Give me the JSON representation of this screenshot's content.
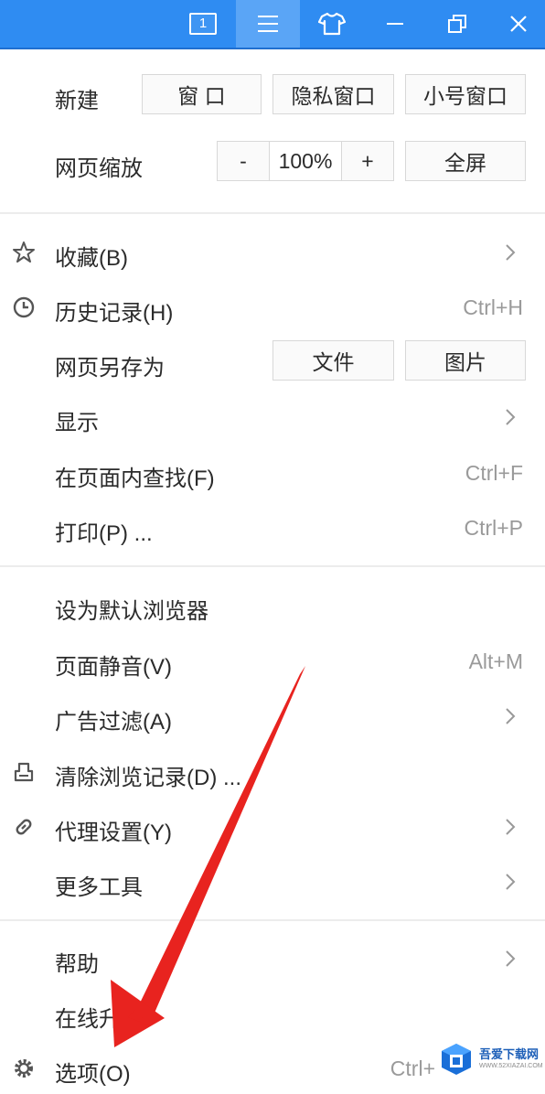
{
  "titlebar": {
    "tab_count": "1",
    "buttons": [
      "tab-count",
      "menu",
      "skin",
      "minimize",
      "restore",
      "close"
    ]
  },
  "new_row": {
    "label": "新建",
    "window": "窗 口",
    "private_window": "隐私窗口",
    "mini_window": "小号窗口"
  },
  "zoom_row": {
    "label": "网页缩放",
    "minus": "-",
    "value": "100%",
    "plus": "+",
    "fullscreen": "全屏"
  },
  "section1": {
    "favorites": {
      "label": "收藏(B)",
      "icon": "star-icon"
    },
    "history": {
      "label": "历史记录(H)",
      "shortcut": "Ctrl+H",
      "icon": "clock-icon"
    },
    "save_as": {
      "label": "网页另存为",
      "file": "文件",
      "image": "图片"
    },
    "display": {
      "label": "显示"
    },
    "find": {
      "label": "在页面内查找(F)",
      "shortcut": "Ctrl+F"
    },
    "print": {
      "label": "打印(P) ...",
      "shortcut": "Ctrl+P"
    }
  },
  "section2": {
    "default_browser": {
      "label": "设为默认浏览器"
    },
    "mute": {
      "label": "页面静音(V)",
      "shortcut": "Alt+M"
    },
    "adblock": {
      "label": "广告过滤(A)"
    },
    "clear_history": {
      "label": "清除浏览记录(D) ...",
      "icon": "eraser-icon"
    },
    "proxy": {
      "label": "代理设置(Y)",
      "icon": "link-icon"
    },
    "more_tools": {
      "label": "更多工具"
    }
  },
  "section3": {
    "help": {
      "label": "帮助"
    },
    "online_upgrade": {
      "label": "在线升"
    },
    "options": {
      "label": "选项(O)",
      "shortcut": "Ctrl+",
      "icon": "gear-icon"
    }
  },
  "watermark": {
    "title": "吾爱下载网",
    "subtitle": "WWW.52XIAZAI.COM"
  },
  "colors": {
    "titlebar": "#2f8cf2",
    "arrow": "#e8231f"
  }
}
